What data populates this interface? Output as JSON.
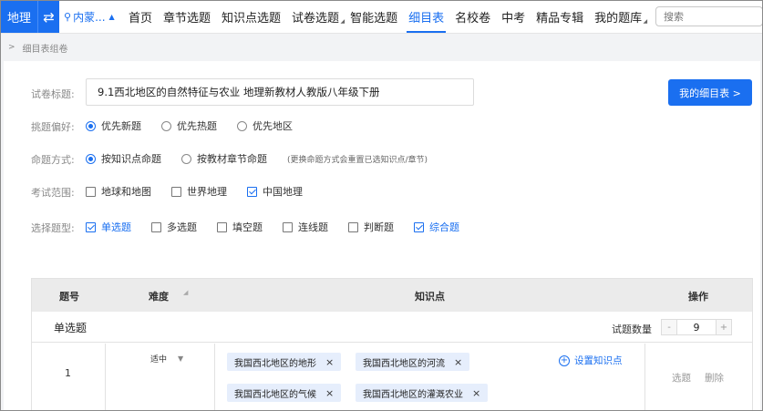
{
  "nav": {
    "subject": "地理",
    "swap_icon": "swap-arrows-icon",
    "region": "内蒙...",
    "items": [
      {
        "label": "首页"
      },
      {
        "label": "章节选题"
      },
      {
        "label": "知识点选题"
      },
      {
        "label": "试卷选题"
      },
      {
        "label": "智能选题"
      },
      {
        "label": "细目表"
      },
      {
        "label": "名校卷"
      },
      {
        "label": "中考"
      },
      {
        "label": "精品专辑"
      },
      {
        "label": "我的题库"
      }
    ],
    "active": "细目表",
    "search_placeholder": "搜索"
  },
  "breadcrumb": {
    "sep": ">",
    "current": "细目表组卷"
  },
  "form": {
    "title_label": "试卷标题:",
    "title_value": "9.1西北地区的自然特征与农业 地理新教材人教版八年级下册",
    "my_button": "我的细目表 >",
    "preference": {
      "label": "挑题偏好:",
      "options": [
        "优先新题",
        "优先热题",
        "优先地区"
      ],
      "selected": "优先新题"
    },
    "mode": {
      "label": "命题方式:",
      "options": [
        "按知识点命题",
        "按教材章节命题"
      ],
      "selected": "按知识点命题",
      "hint": "(更换命题方式会重置已选知识点/章节)"
    },
    "scope": {
      "label": "考试范围:",
      "options": [
        {
          "text": "地球和地图",
          "checked": false
        },
        {
          "text": "世界地理",
          "checked": false
        },
        {
          "text": "中国地理",
          "checked": true
        }
      ]
    },
    "types": {
      "label": "选择题型:",
      "options": [
        {
          "text": "单选题",
          "checked": true
        },
        {
          "text": "多选题",
          "checked": false
        },
        {
          "text": "填空题",
          "checked": false
        },
        {
          "text": "连线题",
          "checked": false
        },
        {
          "text": "判断题",
          "checked": false
        },
        {
          "text": "综合题",
          "checked": true
        }
      ]
    }
  },
  "table": {
    "headers": {
      "num": "题号",
      "difficulty": "难度",
      "knowledge": "知识点",
      "actions": "操作"
    },
    "section": {
      "title": "单选题",
      "qty_label": "试题数量",
      "minus": "-",
      "qty": "9",
      "plus": "+"
    },
    "rows": [
      {
        "num": "1",
        "difficulty": "适中",
        "tags": [
          "我国西北地区的地形",
          "我国西北地区的河流",
          "我国西北地区的气候",
          "我国西北地区的灌溉农业"
        ],
        "remove_symbol": "×",
        "set_kp": "设置知识点",
        "select": "选题",
        "delete": "删除"
      }
    ]
  },
  "colors": {
    "accent": "#1a6ff0",
    "tag_bg": "#e6eefc"
  }
}
